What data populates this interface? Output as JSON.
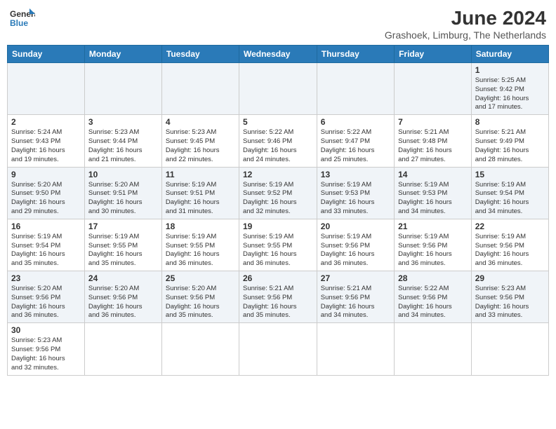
{
  "header": {
    "logo_general": "General",
    "logo_blue": "Blue",
    "month_year": "June 2024",
    "location": "Grashoek, Limburg, The Netherlands"
  },
  "weekdays": [
    "Sunday",
    "Monday",
    "Tuesday",
    "Wednesday",
    "Thursday",
    "Friday",
    "Saturday"
  ],
  "weeks": [
    [
      {
        "day": "",
        "info": ""
      },
      {
        "day": "",
        "info": ""
      },
      {
        "day": "",
        "info": ""
      },
      {
        "day": "",
        "info": ""
      },
      {
        "day": "",
        "info": ""
      },
      {
        "day": "",
        "info": ""
      },
      {
        "day": "1",
        "info": "Sunrise: 5:25 AM\nSunset: 9:42 PM\nDaylight: 16 hours\nand 17 minutes."
      }
    ],
    [
      {
        "day": "2",
        "info": "Sunrise: 5:24 AM\nSunset: 9:43 PM\nDaylight: 16 hours\nand 19 minutes."
      },
      {
        "day": "3",
        "info": "Sunrise: 5:23 AM\nSunset: 9:44 PM\nDaylight: 16 hours\nand 21 minutes."
      },
      {
        "day": "4",
        "info": "Sunrise: 5:23 AM\nSunset: 9:45 PM\nDaylight: 16 hours\nand 22 minutes."
      },
      {
        "day": "5",
        "info": "Sunrise: 5:22 AM\nSunset: 9:46 PM\nDaylight: 16 hours\nand 24 minutes."
      },
      {
        "day": "6",
        "info": "Sunrise: 5:22 AM\nSunset: 9:47 PM\nDaylight: 16 hours\nand 25 minutes."
      },
      {
        "day": "7",
        "info": "Sunrise: 5:21 AM\nSunset: 9:48 PM\nDaylight: 16 hours\nand 27 minutes."
      },
      {
        "day": "8",
        "info": "Sunrise: 5:21 AM\nSunset: 9:49 PM\nDaylight: 16 hours\nand 28 minutes."
      }
    ],
    [
      {
        "day": "9",
        "info": "Sunrise: 5:20 AM\nSunset: 9:50 PM\nDaylight: 16 hours\nand 29 minutes."
      },
      {
        "day": "10",
        "info": "Sunrise: 5:20 AM\nSunset: 9:51 PM\nDaylight: 16 hours\nand 30 minutes."
      },
      {
        "day": "11",
        "info": "Sunrise: 5:19 AM\nSunset: 9:51 PM\nDaylight: 16 hours\nand 31 minutes."
      },
      {
        "day": "12",
        "info": "Sunrise: 5:19 AM\nSunset: 9:52 PM\nDaylight: 16 hours\nand 32 minutes."
      },
      {
        "day": "13",
        "info": "Sunrise: 5:19 AM\nSunset: 9:53 PM\nDaylight: 16 hours\nand 33 minutes."
      },
      {
        "day": "14",
        "info": "Sunrise: 5:19 AM\nSunset: 9:53 PM\nDaylight: 16 hours\nand 34 minutes."
      },
      {
        "day": "15",
        "info": "Sunrise: 5:19 AM\nSunset: 9:54 PM\nDaylight: 16 hours\nand 34 minutes."
      }
    ],
    [
      {
        "day": "16",
        "info": "Sunrise: 5:19 AM\nSunset: 9:54 PM\nDaylight: 16 hours\nand 35 minutes."
      },
      {
        "day": "17",
        "info": "Sunrise: 5:19 AM\nSunset: 9:55 PM\nDaylight: 16 hours\nand 35 minutes."
      },
      {
        "day": "18",
        "info": "Sunrise: 5:19 AM\nSunset: 9:55 PM\nDaylight: 16 hours\nand 36 minutes."
      },
      {
        "day": "19",
        "info": "Sunrise: 5:19 AM\nSunset: 9:55 PM\nDaylight: 16 hours\nand 36 minutes."
      },
      {
        "day": "20",
        "info": "Sunrise: 5:19 AM\nSunset: 9:56 PM\nDaylight: 16 hours\nand 36 minutes."
      },
      {
        "day": "21",
        "info": "Sunrise: 5:19 AM\nSunset: 9:56 PM\nDaylight: 16 hours\nand 36 minutes."
      },
      {
        "day": "22",
        "info": "Sunrise: 5:19 AM\nSunset: 9:56 PM\nDaylight: 16 hours\nand 36 minutes."
      }
    ],
    [
      {
        "day": "23",
        "info": "Sunrise: 5:20 AM\nSunset: 9:56 PM\nDaylight: 16 hours\nand 36 minutes."
      },
      {
        "day": "24",
        "info": "Sunrise: 5:20 AM\nSunset: 9:56 PM\nDaylight: 16 hours\nand 36 minutes."
      },
      {
        "day": "25",
        "info": "Sunrise: 5:20 AM\nSunset: 9:56 PM\nDaylight: 16 hours\nand 35 minutes."
      },
      {
        "day": "26",
        "info": "Sunrise: 5:21 AM\nSunset: 9:56 PM\nDaylight: 16 hours\nand 35 minutes."
      },
      {
        "day": "27",
        "info": "Sunrise: 5:21 AM\nSunset: 9:56 PM\nDaylight: 16 hours\nand 34 minutes."
      },
      {
        "day": "28",
        "info": "Sunrise: 5:22 AM\nSunset: 9:56 PM\nDaylight: 16 hours\nand 34 minutes."
      },
      {
        "day": "29",
        "info": "Sunrise: 5:23 AM\nSunset: 9:56 PM\nDaylight: 16 hours\nand 33 minutes."
      }
    ],
    [
      {
        "day": "30",
        "info": "Sunrise: 5:23 AM\nSunset: 9:56 PM\nDaylight: 16 hours\nand 32 minutes."
      },
      {
        "day": "",
        "info": ""
      },
      {
        "day": "",
        "info": ""
      },
      {
        "day": "",
        "info": ""
      },
      {
        "day": "",
        "info": ""
      },
      {
        "day": "",
        "info": ""
      },
      {
        "day": "",
        "info": ""
      }
    ]
  ]
}
